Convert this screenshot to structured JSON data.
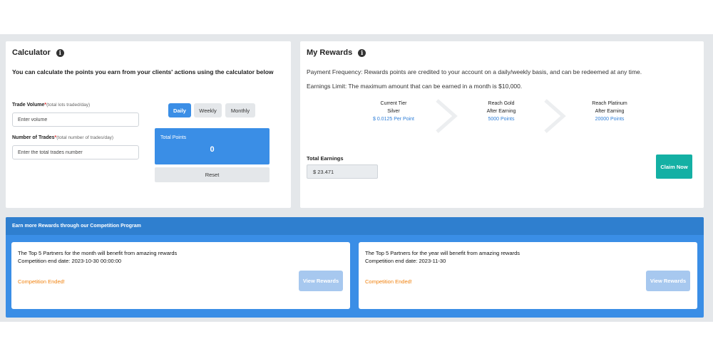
{
  "calculator": {
    "title": "Calculator",
    "description": "You can calculate the points you earn from your clients' actions using the calculator below",
    "trade_volume": {
      "label": "Trade Volume",
      "required": "*",
      "hint": "(total lots traded/day)",
      "placeholder": "Enter volume"
    },
    "num_trades": {
      "label": "Number of Trades",
      "required": "*",
      "hint": "(total number of trades/day)",
      "placeholder": "Enter the total trades number"
    },
    "periods": [
      "Daily",
      "Weekly",
      "Monthly"
    ],
    "active_period": "Daily",
    "total_points_label": "Total Points",
    "total_points_value": "0",
    "reset_label": "Reset"
  },
  "rewards": {
    "title": "My Rewards",
    "payment_frequency": "Payment Frequency: Rewards points are credited to your account on a daily/weekly basis, and can be redeemed at any time.",
    "earnings_limit": "Earnings Limit: The maximum amount that can be earned in a month is $10,000.",
    "tiers": [
      {
        "line1": "Current Tier",
        "line2": "Silver",
        "line3": "$ 0.0125 Per Point"
      },
      {
        "line1": "Reach Gold",
        "line2": "After Earning",
        "line3": "5000 Points"
      },
      {
        "line1": "Reach Platinum",
        "line2": "After Earning",
        "line3": "20000 Points"
      }
    ],
    "total_earnings_label": "Total Earnings",
    "total_earnings_value": "$ 23.471",
    "claim_label": "Claim Now"
  },
  "competition": {
    "header": "Earn more Rewards through our Competition Program",
    "cards": [
      {
        "title": "The Top 5 Partners for the month will benefit from amazing rewards",
        "end_date": "Competition end date: 2023-10-30 00:00:00",
        "status": "Competition Ended!",
        "button": "View Rewards"
      },
      {
        "title": "The Top 5 Partners for the year will benefit from amazing rewards",
        "end_date": "Competition end date: 2023-11-30",
        "status": "Competition Ended!",
        "button": "View Rewards"
      }
    ]
  },
  "icons": {
    "info": "info-icon",
    "chevron": "chevron-right-icon"
  },
  "colors": {
    "accent": "#3a8ee6",
    "claim": "#14b0a4",
    "ended": "#f0820f",
    "link": "#2f7fd8"
  }
}
